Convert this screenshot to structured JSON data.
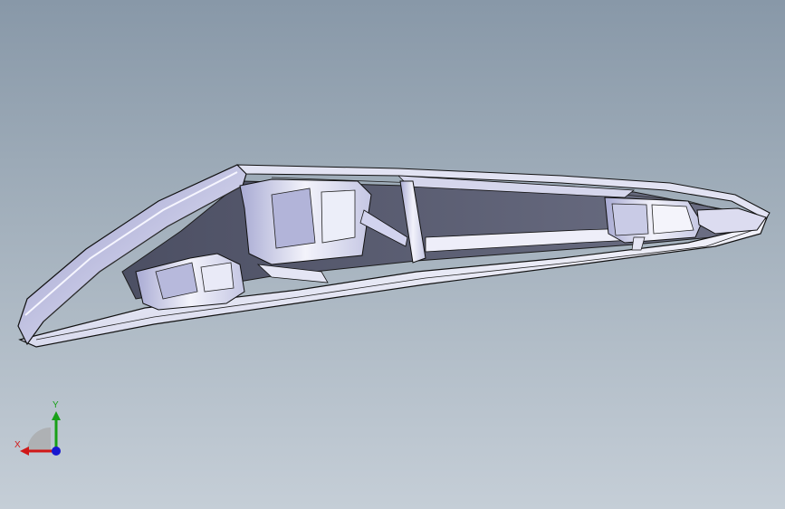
{
  "view": {
    "background_top": "#8898a8",
    "background_bottom": "#c5ced7",
    "model_face_color": "#ffffff",
    "model_shade_color": "#8f91bf",
    "model_edge_color": "#000000"
  },
  "triad": {
    "x_label": "X",
    "y_label": "Y",
    "x_color": "#d01818",
    "y_color": "#18a018",
    "z_color": "#1818d0",
    "icons": [
      "x-axis-arrow-icon",
      "y-axis-arrow-icon",
      "z-axis-dot-icon"
    ]
  }
}
